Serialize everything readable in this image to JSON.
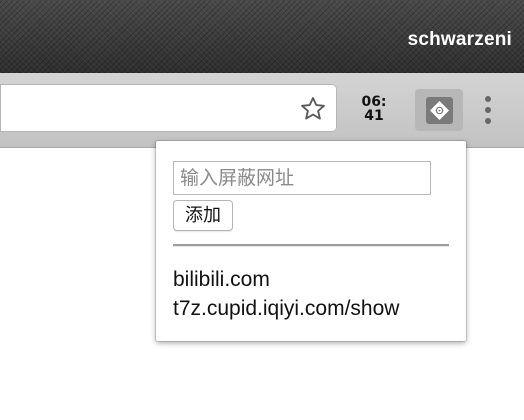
{
  "titlebar": {
    "profile_name": "schwarzeni"
  },
  "toolbar": {
    "bookmark_icon": "star-icon",
    "clock": {
      "hours": "06:",
      "minutes": "41"
    },
    "extension_icon": "puzzle-diamond-icon",
    "menu_icon": "more-vert-icon"
  },
  "popup": {
    "input_placeholder": "输入屏蔽网址",
    "input_value": "",
    "add_button_label": "添加",
    "blocked_sites": [
      "bilibili.com",
      "t7z.cupid.iqiyi.com/show"
    ]
  }
}
